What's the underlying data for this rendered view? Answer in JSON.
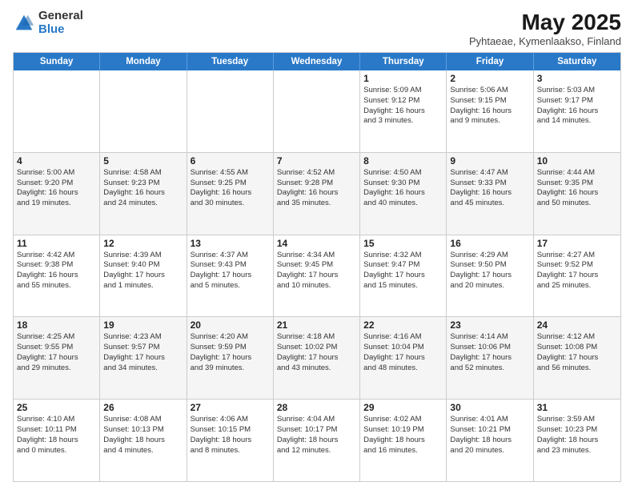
{
  "logo": {
    "general": "General",
    "blue": "Blue"
  },
  "title": {
    "main": "May 2025",
    "sub": "Pyhtaeae, Kymenlaakso, Finland"
  },
  "header_days": [
    "Sunday",
    "Monday",
    "Tuesday",
    "Wednesday",
    "Thursday",
    "Friday",
    "Saturday"
  ],
  "weeks": [
    [
      {
        "day": "",
        "info": ""
      },
      {
        "day": "",
        "info": ""
      },
      {
        "day": "",
        "info": ""
      },
      {
        "day": "",
        "info": ""
      },
      {
        "day": "1",
        "info": "Sunrise: 5:09 AM\nSunset: 9:12 PM\nDaylight: 16 hours\nand 3 minutes."
      },
      {
        "day": "2",
        "info": "Sunrise: 5:06 AM\nSunset: 9:15 PM\nDaylight: 16 hours\nand 9 minutes."
      },
      {
        "day": "3",
        "info": "Sunrise: 5:03 AM\nSunset: 9:17 PM\nDaylight: 16 hours\nand 14 minutes."
      }
    ],
    [
      {
        "day": "4",
        "info": "Sunrise: 5:00 AM\nSunset: 9:20 PM\nDaylight: 16 hours\nand 19 minutes."
      },
      {
        "day": "5",
        "info": "Sunrise: 4:58 AM\nSunset: 9:23 PM\nDaylight: 16 hours\nand 24 minutes."
      },
      {
        "day": "6",
        "info": "Sunrise: 4:55 AM\nSunset: 9:25 PM\nDaylight: 16 hours\nand 30 minutes."
      },
      {
        "day": "7",
        "info": "Sunrise: 4:52 AM\nSunset: 9:28 PM\nDaylight: 16 hours\nand 35 minutes."
      },
      {
        "day": "8",
        "info": "Sunrise: 4:50 AM\nSunset: 9:30 PM\nDaylight: 16 hours\nand 40 minutes."
      },
      {
        "day": "9",
        "info": "Sunrise: 4:47 AM\nSunset: 9:33 PM\nDaylight: 16 hours\nand 45 minutes."
      },
      {
        "day": "10",
        "info": "Sunrise: 4:44 AM\nSunset: 9:35 PM\nDaylight: 16 hours\nand 50 minutes."
      }
    ],
    [
      {
        "day": "11",
        "info": "Sunrise: 4:42 AM\nSunset: 9:38 PM\nDaylight: 16 hours\nand 55 minutes."
      },
      {
        "day": "12",
        "info": "Sunrise: 4:39 AM\nSunset: 9:40 PM\nDaylight: 17 hours\nand 1 minutes."
      },
      {
        "day": "13",
        "info": "Sunrise: 4:37 AM\nSunset: 9:43 PM\nDaylight: 17 hours\nand 5 minutes."
      },
      {
        "day": "14",
        "info": "Sunrise: 4:34 AM\nSunset: 9:45 PM\nDaylight: 17 hours\nand 10 minutes."
      },
      {
        "day": "15",
        "info": "Sunrise: 4:32 AM\nSunset: 9:47 PM\nDaylight: 17 hours\nand 15 minutes."
      },
      {
        "day": "16",
        "info": "Sunrise: 4:29 AM\nSunset: 9:50 PM\nDaylight: 17 hours\nand 20 minutes."
      },
      {
        "day": "17",
        "info": "Sunrise: 4:27 AM\nSunset: 9:52 PM\nDaylight: 17 hours\nand 25 minutes."
      }
    ],
    [
      {
        "day": "18",
        "info": "Sunrise: 4:25 AM\nSunset: 9:55 PM\nDaylight: 17 hours\nand 29 minutes."
      },
      {
        "day": "19",
        "info": "Sunrise: 4:23 AM\nSunset: 9:57 PM\nDaylight: 17 hours\nand 34 minutes."
      },
      {
        "day": "20",
        "info": "Sunrise: 4:20 AM\nSunset: 9:59 PM\nDaylight: 17 hours\nand 39 minutes."
      },
      {
        "day": "21",
        "info": "Sunrise: 4:18 AM\nSunset: 10:02 PM\nDaylight: 17 hours\nand 43 minutes."
      },
      {
        "day": "22",
        "info": "Sunrise: 4:16 AM\nSunset: 10:04 PM\nDaylight: 17 hours\nand 48 minutes."
      },
      {
        "day": "23",
        "info": "Sunrise: 4:14 AM\nSunset: 10:06 PM\nDaylight: 17 hours\nand 52 minutes."
      },
      {
        "day": "24",
        "info": "Sunrise: 4:12 AM\nSunset: 10:08 PM\nDaylight: 17 hours\nand 56 minutes."
      }
    ],
    [
      {
        "day": "25",
        "info": "Sunrise: 4:10 AM\nSunset: 10:11 PM\nDaylight: 18 hours\nand 0 minutes."
      },
      {
        "day": "26",
        "info": "Sunrise: 4:08 AM\nSunset: 10:13 PM\nDaylight: 18 hours\nand 4 minutes."
      },
      {
        "day": "27",
        "info": "Sunrise: 4:06 AM\nSunset: 10:15 PM\nDaylight: 18 hours\nand 8 minutes."
      },
      {
        "day": "28",
        "info": "Sunrise: 4:04 AM\nSunset: 10:17 PM\nDaylight: 18 hours\nand 12 minutes."
      },
      {
        "day": "29",
        "info": "Sunrise: 4:02 AM\nSunset: 10:19 PM\nDaylight: 18 hours\nand 16 minutes."
      },
      {
        "day": "30",
        "info": "Sunrise: 4:01 AM\nSunset: 10:21 PM\nDaylight: 18 hours\nand 20 minutes."
      },
      {
        "day": "31",
        "info": "Sunrise: 3:59 AM\nSunset: 10:23 PM\nDaylight: 18 hours\nand 23 minutes."
      }
    ]
  ]
}
